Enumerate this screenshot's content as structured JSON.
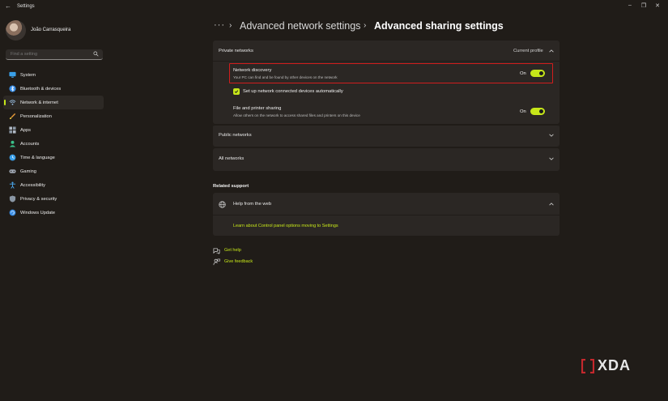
{
  "window": {
    "title": "Settings"
  },
  "profile": {
    "name": "João Carrasqueira"
  },
  "search": {
    "placeholder": "Find a setting"
  },
  "sidebar": {
    "items": [
      {
        "label": "System",
        "icon": "monitor-icon",
        "color": "#3aa0e8"
      },
      {
        "label": "Bluetooth & devices",
        "icon": "bluetooth-icon",
        "color": "#3a8fe8"
      },
      {
        "label": "Network & internet",
        "icon": "wifi-icon",
        "color": "#9fc8ee",
        "active": true
      },
      {
        "label": "Personalization",
        "icon": "brush-icon",
        "color": "#e89a3a"
      },
      {
        "label": "Apps",
        "icon": "apps-icon",
        "color": "#b0b8c4"
      },
      {
        "label": "Accounts",
        "icon": "person-icon",
        "color": "#3ac28a"
      },
      {
        "label": "Time & language",
        "icon": "globe-clock-icon",
        "color": "#3a9fe8"
      },
      {
        "label": "Gaming",
        "icon": "gamepad-icon",
        "color": "#a0a8b4"
      },
      {
        "label": "Accessibility",
        "icon": "accessibility-icon",
        "color": "#4aa8f0"
      },
      {
        "label": "Privacy & security",
        "icon": "shield-icon",
        "color": "#8a96a4"
      },
      {
        "label": "Windows Update",
        "icon": "update-icon",
        "color": "#3a8fe8"
      }
    ]
  },
  "breadcrumb": {
    "more": "···",
    "parent": "Advanced network settings",
    "current": "Advanced sharing settings"
  },
  "private_networks": {
    "title": "Private networks",
    "status": "Current profile",
    "network_discovery": {
      "title": "Network discovery",
      "description": "Your PC can find and be found by other devices on the network",
      "state": "On"
    },
    "auto_setup": {
      "label": "Set up network connected devices automatically",
      "checked": true
    },
    "file_sharing": {
      "title": "File and printer sharing",
      "description": "Allow others on the network to access shared files and printers on this device",
      "state": "On"
    }
  },
  "public_networks": {
    "title": "Public networks"
  },
  "all_networks": {
    "title": "All networks"
  },
  "related_support": {
    "heading": "Related support",
    "help_title": "Help from the web",
    "link": "Learn about Control panel options moving to Settings"
  },
  "footer": {
    "get_help": "Get help",
    "give_feedback": "Give feedback"
  },
  "watermark": {
    "text": "XDA"
  },
  "colors": {
    "accent": "#c6e619",
    "highlight": "#d11d1d",
    "background": "#201c18",
    "card": "#2b2724"
  }
}
